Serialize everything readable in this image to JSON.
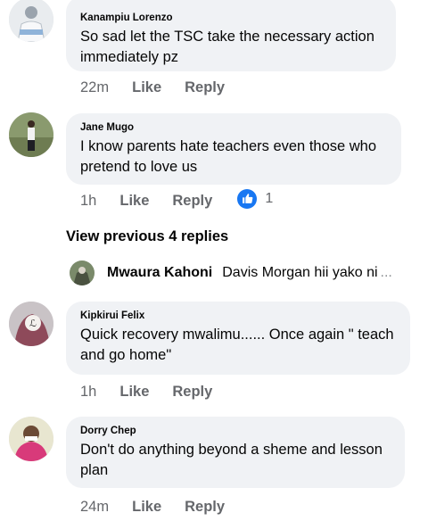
{
  "comments": [
    {
      "author": "Kanampiu Lorenzo",
      "text": "So sad let the TSC take the necessary action immediately pz",
      "time": "22m",
      "like": "Like",
      "reply": "Reply"
    },
    {
      "author": "Jane Mugo",
      "text": "I know parents hate teachers even those who pretend to love us",
      "time": "1h",
      "like": "Like",
      "reply": "Reply",
      "reaction_count": "1",
      "reaction_icon": "thumbs-up-icon"
    },
    {
      "author": "Kipkirui Felix",
      "text": "Quick recovery mwalimu...... Once again \" teach and go home\"",
      "time": "1h",
      "like": "Like",
      "reply": "Reply"
    },
    {
      "author": "Dorry Chep",
      "text": "Don't do anything beyond a sheme and lesson plan",
      "time": "24m",
      "like": "Like",
      "reply": "Reply"
    }
  ],
  "thread": {
    "view_previous": "View previous 4 replies",
    "preview_author": "Mwaura Kahoni",
    "preview_text": "Davis Morgan hii yako ni",
    "preview_more": "..."
  },
  "colors": {
    "bubble": "#f0f2f5",
    "meta": "#65676b",
    "like_blue": "#1877f2"
  }
}
